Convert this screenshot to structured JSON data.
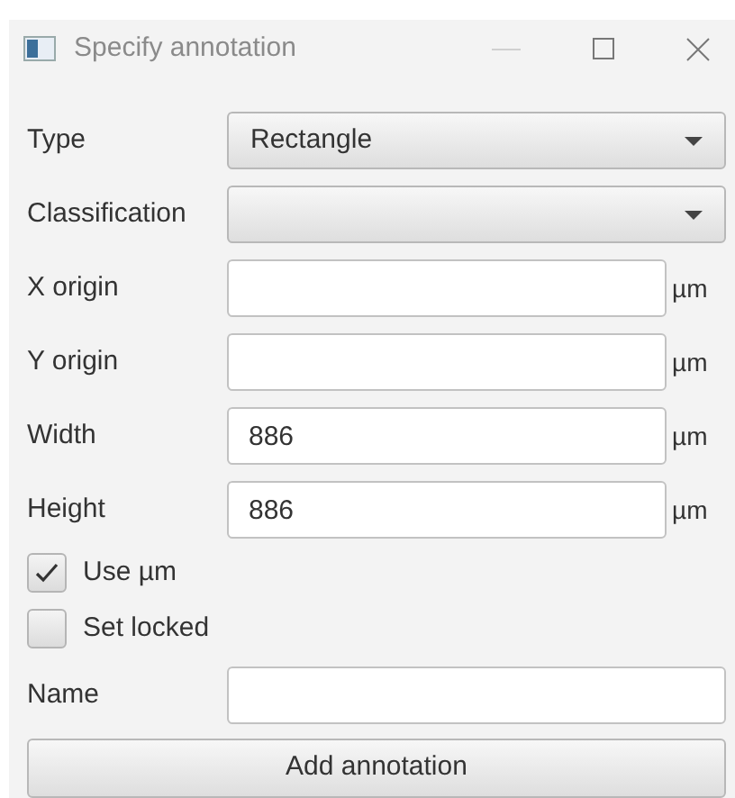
{
  "window": {
    "title": "Specify annotation"
  },
  "dropdowns": [
    {
      "label": "Type",
      "value": "Rectangle"
    },
    {
      "label": "Classification"
    }
  ],
  "fields": [
    {
      "label": "X origin",
      "unit": "µm"
    },
    {
      "label": "Y origin",
      "unit": "µm"
    },
    {
      "label": "Width",
      "value": "886",
      "unit": "µm"
    },
    {
      "label": "Height",
      "value": "886",
      "unit": "µm"
    }
  ],
  "checkboxes": [
    {
      "label": "Use µm",
      "checked": true
    },
    {
      "label": "Set locked",
      "checked": false
    }
  ],
  "name_field": {
    "label": "Name"
  },
  "button": "Add annotation"
}
